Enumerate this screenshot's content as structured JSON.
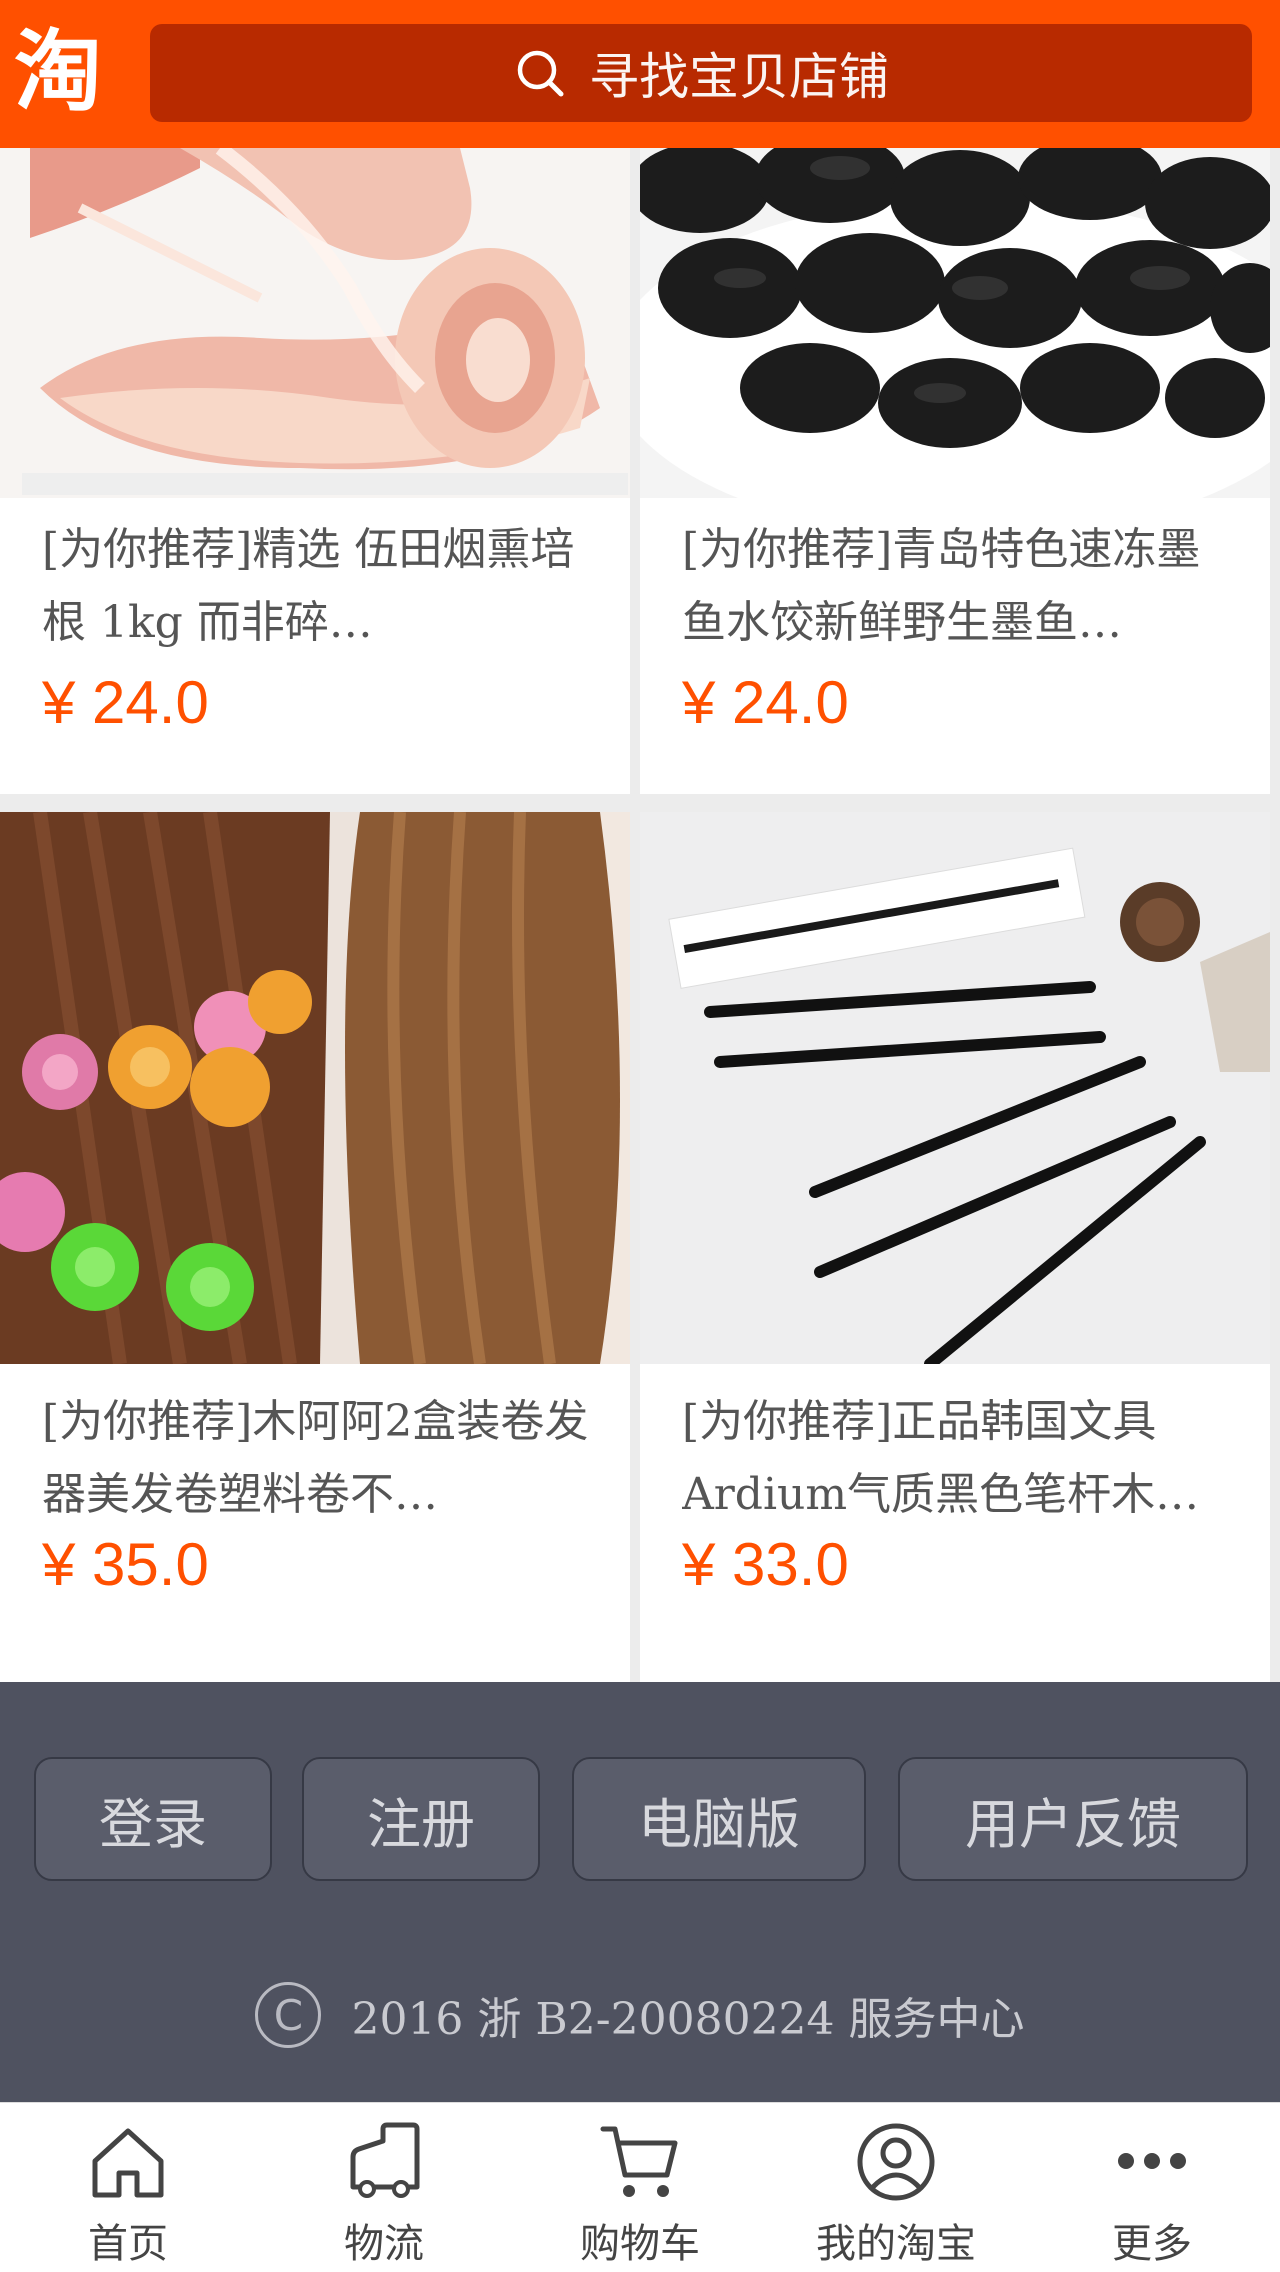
{
  "header": {
    "logo_text": "淘",
    "search_placeholder": "寻找宝贝店铺"
  },
  "products": [
    {
      "title": "[为你推荐]精选 伍田烟熏培根 1kg 而非碎…",
      "price": "¥ 24.0",
      "image": "bacon-photo"
    },
    {
      "title": "[为你推荐]青岛特色速冻墨鱼水饺新鲜野生墨鱼…",
      "price": "¥ 24.0",
      "image": "squid-ink-dumplings-photo"
    },
    {
      "title": "[为你推荐]木阿阿2盒装卷发器美发卷塑料卷不…",
      "price": "¥ 35.0",
      "image": "hair-curlers-photo"
    },
    {
      "title": "[为你推荐]正品韩国文具Ardium气质黑色笔杆木…",
      "price": "¥ 33.0",
      "image": "black-pencils-photo"
    }
  ],
  "footer": {
    "buttons": [
      "登录",
      "注册",
      "电脑版",
      "用户反馈"
    ],
    "copyright_symbol": "C",
    "copyright": "2016 浙 B2-20080224 服务中心"
  },
  "tabbar": [
    {
      "label": "首页",
      "icon": "home-icon"
    },
    {
      "label": "物流",
      "icon": "truck-icon"
    },
    {
      "label": "购物车",
      "icon": "cart-icon"
    },
    {
      "label": "我的淘宝",
      "icon": "user-icon"
    },
    {
      "label": "更多",
      "icon": "more-icon"
    }
  ],
  "colors": {
    "brand": "#ff5000",
    "search_bg": "#b82a00",
    "footer_bg": "#4f5260"
  }
}
